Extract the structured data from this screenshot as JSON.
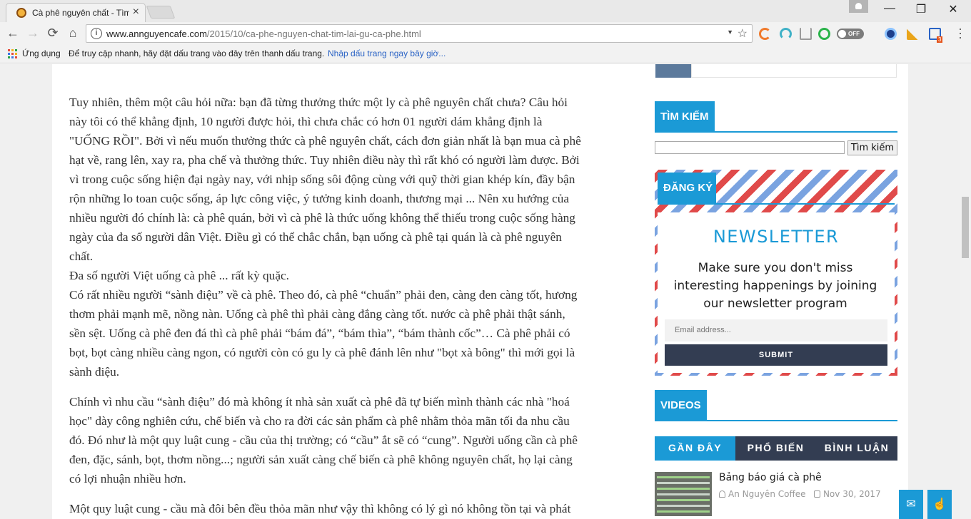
{
  "browser": {
    "tab_title": "Cà phê nguyên chất - Tìm lại gu cà phê",
    "url_host": "www.annguyencafe.com",
    "url_path": "/2015/10/ca-phe-nguyen-chat-tim-lai-gu-ca-phe.html",
    "extension_toggle": "OFF",
    "extension_badge": "3",
    "window_minimize": "—",
    "window_restore": "❐",
    "window_close": "✕",
    "tab_close": "×",
    "back": "←",
    "forward": "→",
    "reload": "⟳",
    "home": "⌂",
    "star": "☆",
    "info": "i",
    "dropdown": "▼"
  },
  "bookmarks": {
    "apps": "Ứng dụng",
    "hint": "Để truy cập nhanh, hãy đặt dấu trang vào đây trên thanh dấu trang.",
    "import_link": "Nhập dấu trang ngay bây giờ..."
  },
  "article": {
    "p1": [
      "Tuy nhiên, thêm một câu hỏi nữa: bạn đã từng thưởng thức một ly cà phê nguyên chất chưa? Câu hỏi",
      "này tôi có thể khẳng định, 10 người được hỏi, thì chưa chắc có hơn 01 người dám khẳng định là",
      "\"UỐNG RỒI\". Bởi vì nếu muốn thưởng thức cà phê nguyên chất, cách đơn giản nhất là bạn mua cà phê",
      "hạt về, rang lên, xay ra, pha chế và thưởng thức. Tuy nhiên điều này thì rất khó có người làm được. Bởi",
      "vì trong cuộc sống hiện đại ngày nay, với nhịp sống sôi động cùng với quỹ thời gian khép kín, đầy bận",
      "rộn những lo toan cuộc sống, áp lực công việc, ý tưởng kinh doanh, thương mại ... Nên xu hướng của",
      "nhiều người đó chính là: cà phê quán, bởi vì cà phê là thức uống không thể thiếu trong cuộc sống hàng",
      "ngày của đa số người dân Việt. Điều gì có thể chắc chắn, bạn uống cà phê tại quán là cà phê nguyên",
      "chất.",
      " Đa số người Việt uống cà phê ... rất kỳ quặc.",
      "Có rất nhiều người “sành điệu” về cà phê. Theo đó, cà phê “chuẩn” phải đen, càng đen càng tốt, hương",
      "thơm phải mạnh mẽ, nồng nàn. Uống cà phê thì phải càng đắng càng tốt. nước cà phê phải thật sánh,",
      "sền sệt. Uống cà phê đen đá thì cà phê phải “bám đá”, “bám thìa”, “bám thành cốc”… Cà phê phải có",
      "bọt, bọt càng nhiều càng ngon, có người còn có gu ly cà phê đánh lên như \"bọt xà bông\" thì mới gọi là",
      "sành điệu."
    ],
    "p2": [
      "Chính vì nhu cầu “sành điệu” đó mà không ít nhà sản xuất cà phê đã tự biến mình thành các nhà \"hoá",
      "học\" dày công nghiên cứu, chế biến và cho ra đời các sản phẩm cà phê nhằm thỏa mãn tối đa nhu cầu",
      "đó. Đó như là một quy luật cung - cầu của thị trường; có “cầu” ắt sẽ có “cung”. Người uống cần cà phê",
      "đen, đặc, sánh, bọt, thơm nồng...; người sản xuất càng chế biến cà phê không nguyên chất, họ lại càng",
      "có lợi nhuận nhiều hơn."
    ],
    "p3": [
      "Một quy luật cung - cầu mà đôi bên đều thỏa mãn như vậy thì không có lý gì nó không tồn tại và phát"
    ]
  },
  "sidebar": {
    "search_heading": "TÌM KIẾM",
    "search_placeholder": "",
    "search_button": "Tìm kiếm",
    "signup_heading": "ĐĂNG KÝ",
    "newsletter_title": "NEWSLETTER",
    "newsletter_text": "Make sure you don't miss interesting happenings by joining our newsletter program",
    "email_placeholder": "Email address...",
    "submit_label": "SUBMIT",
    "videos_heading": "VIDEOS",
    "tabs": [
      "GẦN ĐÂY",
      "PHỔ BIẾN",
      "BÌNH LUẬN"
    ],
    "post": {
      "title": "Bảng báo giá cà phê",
      "author": "An Nguyên Coffee",
      "date": "Nov 30, 2017"
    }
  },
  "floating": {
    "mail_icon": "✉",
    "touch_icon": "☝"
  },
  "colors": {
    "accent": "#1b9ad6",
    "dark": "#333d52",
    "airmail_red": "#e04a4a",
    "airmail_blue": "#7aa3e0"
  }
}
